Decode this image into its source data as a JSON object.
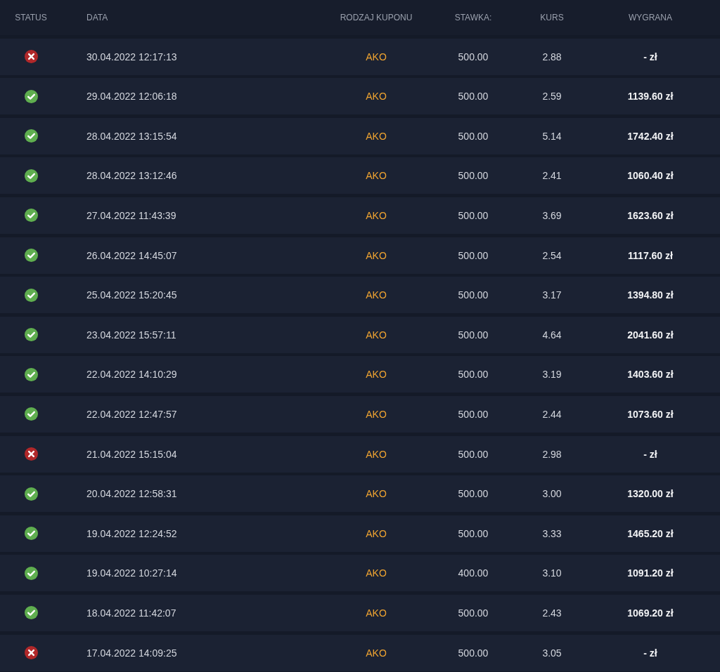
{
  "table": {
    "columns": [
      "STATUS",
      "DATA",
      "RODZAJ KUPONU",
      "STAWKA:",
      "KURS",
      "WYGRANA"
    ],
    "rows": [
      {
        "kind": "lost",
        "date": "30.04.2022 12:17:13",
        "type": "AKO",
        "stake": "500.00",
        "odds": "2.88",
        "win": "- zł"
      },
      {
        "kind": "won",
        "date": "29.04.2022 12:06:18",
        "type": "AKO",
        "stake": "500.00",
        "odds": "2.59",
        "win": "1139.60 zł"
      },
      {
        "kind": "won",
        "date": "28.04.2022 13:15:54",
        "type": "AKO",
        "stake": "500.00",
        "odds": "5.14",
        "win": "1742.40 zł"
      },
      {
        "kind": "won",
        "date": "28.04.2022 13:12:46",
        "type": "AKO",
        "stake": "500.00",
        "odds": "2.41",
        "win": "1060.40 zł"
      },
      {
        "kind": "won",
        "date": "27.04.2022 11:43:39",
        "type": "AKO",
        "stake": "500.00",
        "odds": "3.69",
        "win": "1623.60 zł"
      },
      {
        "kind": "won",
        "date": "26.04.2022 14:45:07",
        "type": "AKO",
        "stake": "500.00",
        "odds": "2.54",
        "win": "1117.60 zł"
      },
      {
        "kind": "won",
        "date": "25.04.2022 15:20:45",
        "type": "AKO",
        "stake": "500.00",
        "odds": "3.17",
        "win": "1394.80 zł"
      },
      {
        "kind": "won",
        "date": "23.04.2022 15:57:11",
        "type": "AKO",
        "stake": "500.00",
        "odds": "4.64",
        "win": "2041.60 zł"
      },
      {
        "kind": "won",
        "date": "22.04.2022 14:10:29",
        "type": "AKO",
        "stake": "500.00",
        "odds": "3.19",
        "win": "1403.60 zł"
      },
      {
        "kind": "won",
        "date": "22.04.2022 12:47:57",
        "type": "AKO",
        "stake": "500.00",
        "odds": "2.44",
        "win": "1073.60 zł"
      },
      {
        "kind": "lost",
        "date": "21.04.2022 15:15:04",
        "type": "AKO",
        "stake": "500.00",
        "odds": "2.98",
        "win": "- zł"
      },
      {
        "kind": "won",
        "date": "20.04.2022 12:58:31",
        "type": "AKO",
        "stake": "500.00",
        "odds": "3.00",
        "win": "1320.00 zł"
      },
      {
        "kind": "won",
        "date": "19.04.2022 12:24:52",
        "type": "AKO",
        "stake": "500.00",
        "odds": "3.33",
        "win": "1465.20 zł"
      },
      {
        "kind": "won",
        "date": "19.04.2022 10:27:14",
        "type": "AKO",
        "stake": "400.00",
        "odds": "3.10",
        "win": "1091.20 zł"
      },
      {
        "kind": "won",
        "date": "18.04.2022 11:42:07",
        "type": "AKO",
        "stake": "500.00",
        "odds": "2.43",
        "win": "1069.20 zł"
      },
      {
        "kind": "lost",
        "date": "17.04.2022 14:09:25",
        "type": "AKO",
        "stake": "500.00",
        "odds": "3.05",
        "win": "- zł"
      }
    ]
  }
}
